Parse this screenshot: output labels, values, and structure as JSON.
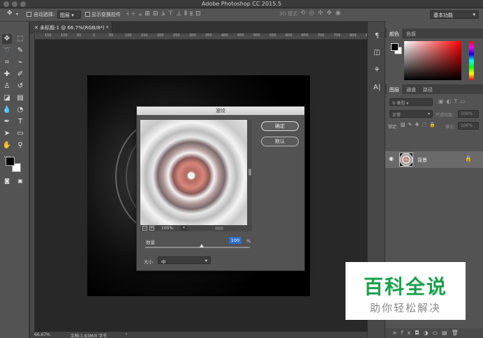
{
  "window": {
    "title": "Adobe Photoshop CC 2015.5"
  },
  "options_bar": {
    "auto_select_label": "自动选择:",
    "auto_select_value": "图层",
    "show_transform_label": "显示变换控件",
    "mode_3d_label": "3D 模式:",
    "workspace": "基本功能"
  },
  "document": {
    "tab_title": "未标题-1 @ 66.7%(RGB/8*) *",
    "zoom": "66.67%",
    "doc_info": "文档:1.83M/0 字节",
    "ruler_ticks": [
      "150",
      "100",
      "50",
      "0",
      "50",
      "100",
      "150",
      "200",
      "250",
      "300",
      "350",
      "400",
      "450",
      "500",
      "550",
      "600",
      "650",
      "700",
      "750",
      "800",
      "850"
    ]
  },
  "dialog": {
    "title": "波纹",
    "ok_label": "确定",
    "default_label": "默认",
    "preview_zoom": "100%",
    "amount_label": "数量",
    "amount_value": "100",
    "amount_unit": "%",
    "amount_fraction": 0.54,
    "size_label": "大小",
    "size_value": "中"
  },
  "panels": {
    "color_tab": "颜色",
    "swatches_tab": "色板",
    "layers_tab": "图层",
    "channels_tab": "通道",
    "paths_tab": "路径",
    "kind_filter": "类型",
    "blend_mode": "正常",
    "opacity_label": "不透明度:",
    "opacity_value": "100%",
    "lock_label": "锁定:",
    "fill_label": "填充:",
    "fill_value": "100%",
    "layer_name": "背景"
  },
  "watermark": {
    "main": "百科全说",
    "sub": "助你轻松解决"
  }
}
